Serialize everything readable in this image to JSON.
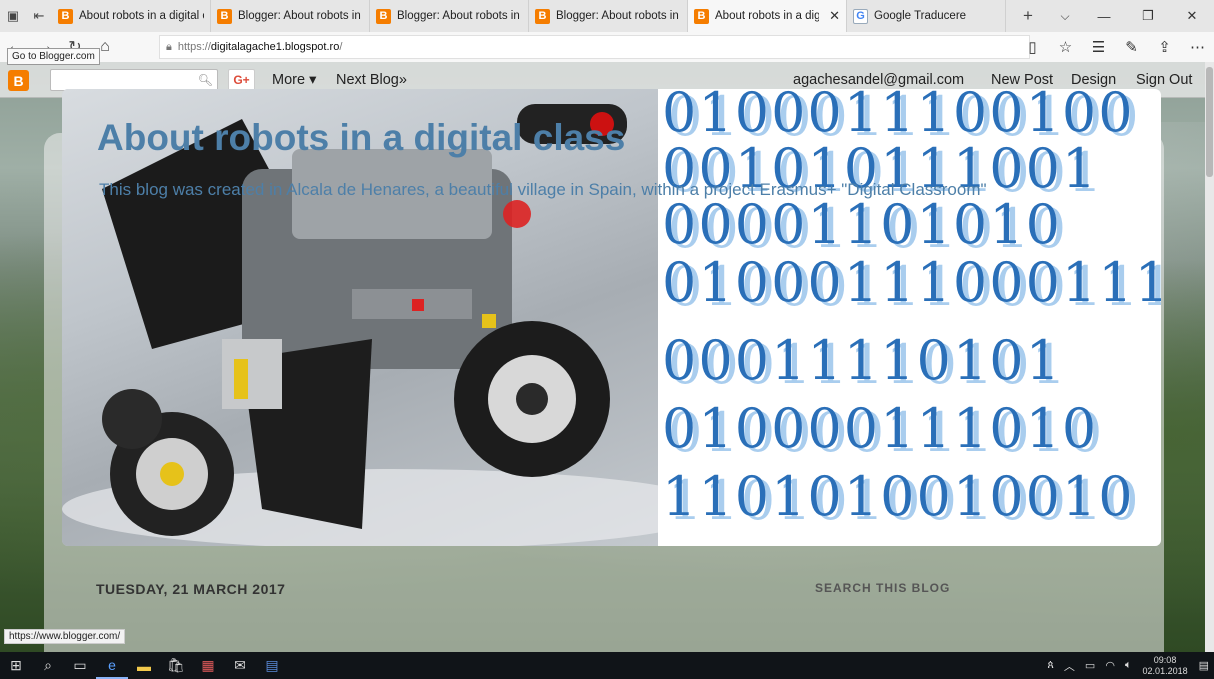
{
  "browser": {
    "tabs": [
      {
        "label": "About robots in a digital cla",
        "icon": "blogger-icon",
        "active": false
      },
      {
        "label": "Blogger: About robots in a d",
        "icon": "blogger-icon",
        "active": false
      },
      {
        "label": "Blogger: About robots in a d",
        "icon": "blogger-icon",
        "active": false
      },
      {
        "label": "Blogger: About robots in a d",
        "icon": "blogger-icon",
        "active": false
      },
      {
        "label": "About robots in a digita",
        "icon": "blogger-icon",
        "active": true
      },
      {
        "label": "Google Traducere",
        "icon": "google-translate-icon",
        "active": false
      }
    ],
    "url_scheme": "https://",
    "url_host": "digitalagache1.blogspot.ro",
    "url_path": "/",
    "tooltip": "Go to Blogger.com",
    "status_url": "https://www.blogger.com/"
  },
  "blogger_bar": {
    "gplus_label": "G+",
    "more_label": "More ▾",
    "next_blog_label": "Next Blog»",
    "email": "agachesandel@gmail.com",
    "new_post_label": "New Post",
    "design_label": "Design",
    "sign_out_label": "Sign Out"
  },
  "blog": {
    "title": "About robots in a digital class",
    "description": "This blog was created in Alcala de Henares, a beautiful village in Spain, within a project Erasmus+ \"Digital Classroom\"",
    "date_heading": "TUESDAY, 21 MARCH 2017",
    "sidebar_heading": "SEARCH THIS BLOG",
    "binary_rows": [
      "0100011100100",
      "001010111001",
      "00001101010",
      "01000111000111",
      "00011110101",
      "010000111010",
      "1101010010010"
    ]
  },
  "taskbar": {
    "time": "09:08",
    "date": "02.01.2018"
  }
}
